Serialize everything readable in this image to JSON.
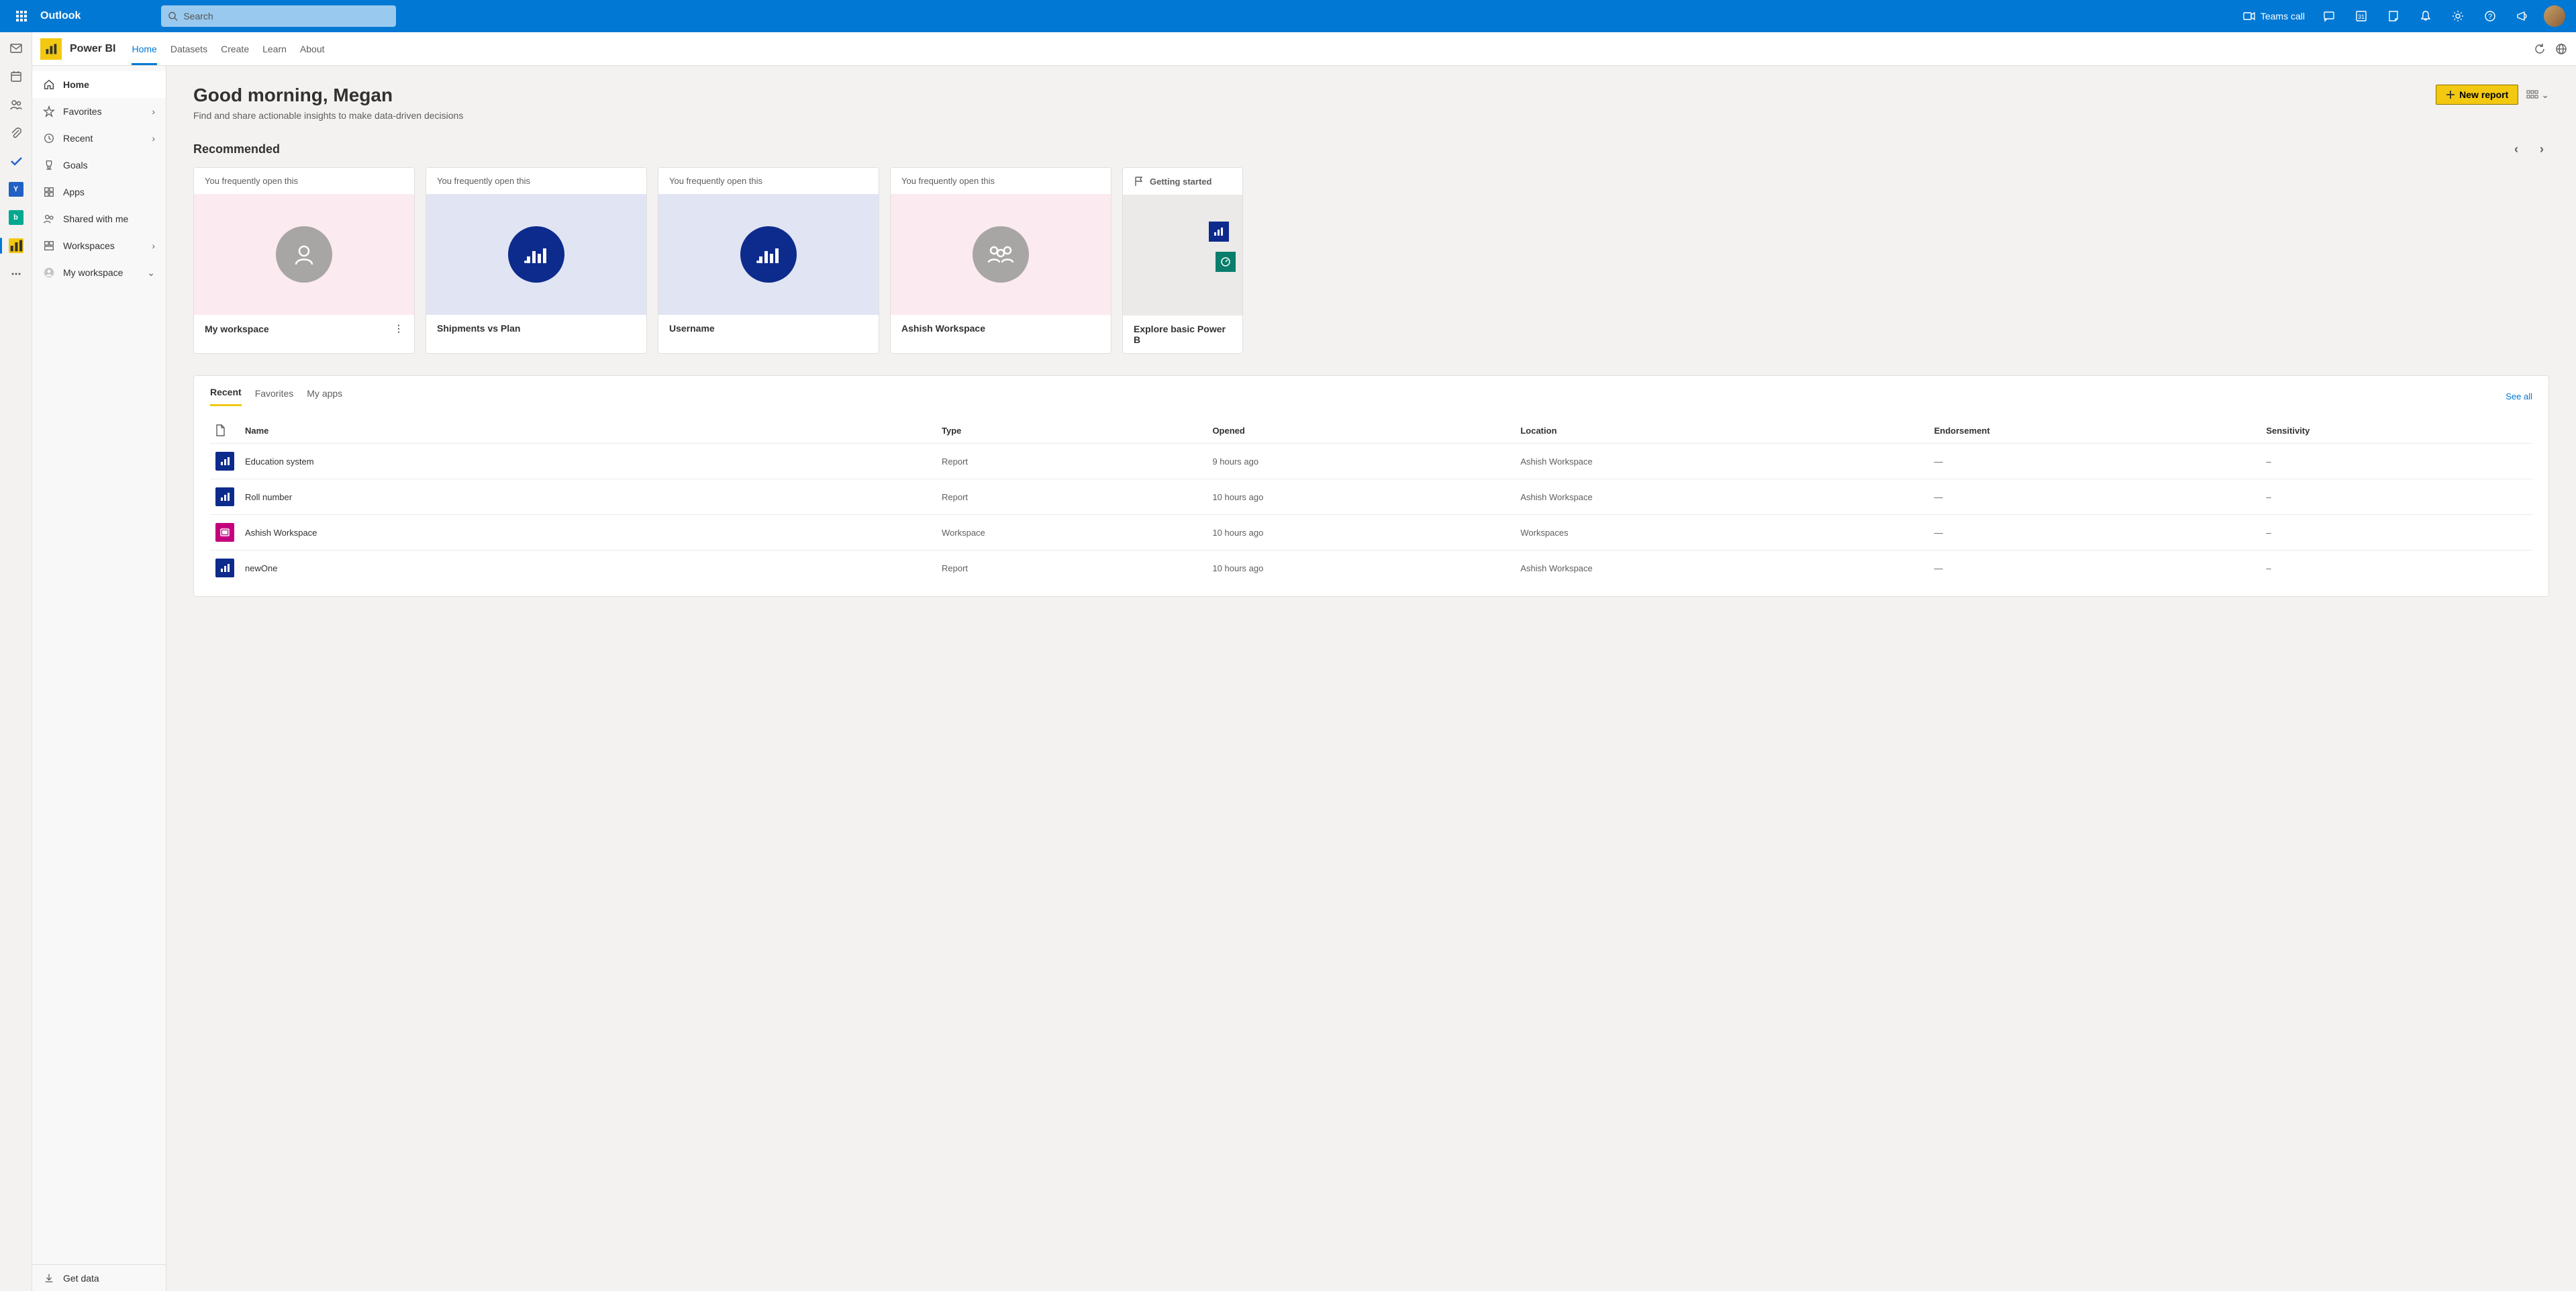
{
  "suite": {
    "title": "Outlook",
    "search_placeholder": "Search",
    "teams_call": "Teams call"
  },
  "pbi_header": {
    "title": "Power BI",
    "tabs": [
      "Home",
      "Datasets",
      "Create",
      "Learn",
      "About"
    ]
  },
  "nav": {
    "items": [
      {
        "label": "Home",
        "chev": false
      },
      {
        "label": "Favorites",
        "chev": true
      },
      {
        "label": "Recent",
        "chev": true
      },
      {
        "label": "Goals",
        "chev": false
      },
      {
        "label": "Apps",
        "chev": false
      },
      {
        "label": "Shared with me",
        "chev": false
      },
      {
        "label": "Workspaces",
        "chev": true
      },
      {
        "label": "My workspace",
        "chev": "down"
      }
    ],
    "get_data": "Get data"
  },
  "greeting": {
    "title": "Good morning, Megan",
    "subtitle": "Find and share actionable insights to make data-driven decisions",
    "new_report": "New report"
  },
  "recommended": {
    "title": "Recommended",
    "subtitle": "You frequently open this",
    "cards": [
      {
        "title": "My workspace",
        "kind": "person",
        "bg": "#fbeaef",
        "circle": "#a8a6a4"
      },
      {
        "title": "Shipments vs Plan",
        "kind": "chart",
        "bg": "#e1e4f3",
        "circle": "#0d2b8c"
      },
      {
        "title": "Username",
        "kind": "chart",
        "bg": "#e1e4f3",
        "circle": "#0d2b8c"
      },
      {
        "title": "Ashish Workspace",
        "kind": "people",
        "bg": "#fbeaef",
        "circle": "#a8a6a4"
      }
    ],
    "getting_started": "Getting started",
    "explore": "Explore basic Power B"
  },
  "recent": {
    "tabs": [
      "Recent",
      "Favorites",
      "My apps"
    ],
    "see_all": "See all",
    "columns": [
      "",
      "Name",
      "Type",
      "Opened",
      "Location",
      "Endorsement",
      "Sensitivity"
    ],
    "rows": [
      {
        "icon": "blue",
        "name": "Education system",
        "type": "Report",
        "opened": "9 hours ago",
        "location": "Ashish Workspace",
        "endorsement": "—",
        "sensitivity": "–"
      },
      {
        "icon": "blue",
        "name": "Roll number",
        "type": "Report",
        "opened": "10 hours ago",
        "location": "Ashish Workspace",
        "endorsement": "—",
        "sensitivity": "–"
      },
      {
        "icon": "pink",
        "name": "Ashish Workspace",
        "type": "Workspace",
        "opened": "10 hours ago",
        "location": "Workspaces",
        "endorsement": "—",
        "sensitivity": "–"
      },
      {
        "icon": "blue",
        "name": "newOne",
        "type": "Report",
        "opened": "10 hours ago",
        "location": "Ashish Workspace",
        "endorsement": "—",
        "sensitivity": "–"
      }
    ]
  }
}
